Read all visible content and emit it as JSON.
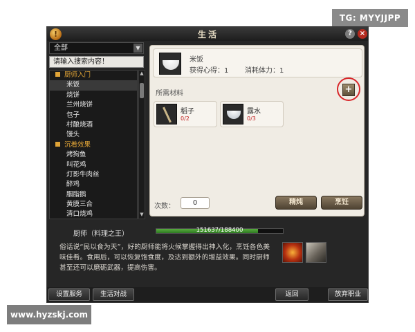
{
  "watermarks": {
    "top": "TG: MYYJJPP",
    "bottom": "www.hyzskj.com"
  },
  "window": {
    "title": "生活"
  },
  "left_panel": {
    "dropdown": "全部",
    "search_placeholder": "请输入搜索内容！",
    "list": [
      {
        "type": "category",
        "label": "厨师入门"
      },
      {
        "type": "item",
        "label": "米饭",
        "selected": true
      },
      {
        "type": "item",
        "label": "烧饼"
      },
      {
        "type": "item",
        "label": "兰州烧饼"
      },
      {
        "type": "item",
        "label": "包子"
      },
      {
        "type": "item",
        "label": "村酿烧酒"
      },
      {
        "type": "item",
        "label": "馒头"
      },
      {
        "type": "category",
        "label": "沉着效果"
      },
      {
        "type": "item",
        "label": "烤狗鱼"
      },
      {
        "type": "item",
        "label": "叫花鸡"
      },
      {
        "type": "item",
        "label": "灯影牛肉丝"
      },
      {
        "type": "item",
        "label": "醉鸡"
      },
      {
        "type": "item",
        "label": "胭脂鹅"
      },
      {
        "type": "item",
        "label": "黄膜三合"
      },
      {
        "type": "item",
        "label": "清口烧鸡"
      }
    ]
  },
  "recipe": {
    "name": "米饭",
    "gain": "获得心得：1",
    "cost": "消耗体力：1"
  },
  "materials": {
    "title": "所需材料",
    "add_label": "+",
    "items": [
      {
        "name": "稻子",
        "count": "0/2",
        "icon": "rice-stalk-icon"
      },
      {
        "name": "露水",
        "count": "0/3",
        "icon": "dew-bowl-icon"
      }
    ]
  },
  "action": {
    "times_label": "次数：",
    "times_value": "0",
    "refine_label": "精炖",
    "cook_label": "烹饪"
  },
  "profession": {
    "title": "厨师（料理之王）",
    "exp_text": "151637/188400",
    "exp_fraction": 0.8049
  },
  "description": "俗话说“民以食为天”，好的厨师能将火候掌握得出神入化，烹饪各色美味佳肴。食用后，可以恢复饱食度，及达到额外的增益效果。同时厨师甚至还可以磨砺武器，提高伤害。",
  "bottom_buttons": {
    "settings": "设置服务",
    "battle": "生活对战",
    "back": "返回",
    "abandon": "放弃职业"
  }
}
